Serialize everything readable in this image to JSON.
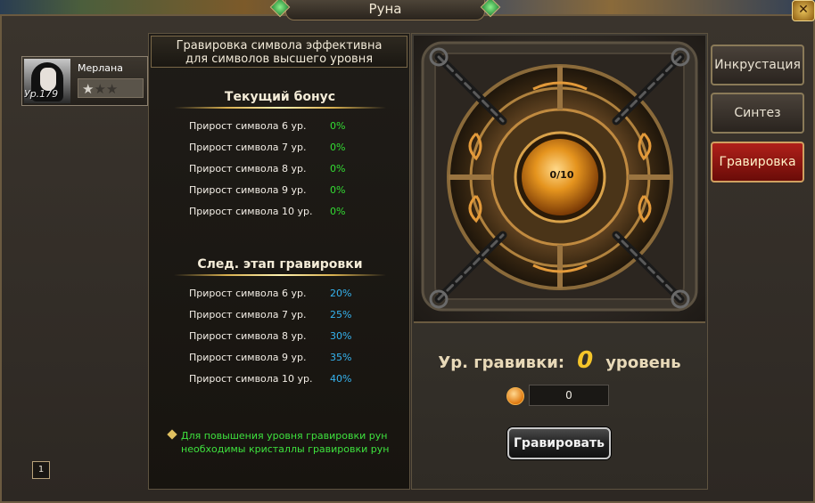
{
  "window": {
    "title": "Руна"
  },
  "character": {
    "name": "Мерлана",
    "level": "Ур.179",
    "stars_filled": 1,
    "stars_total": 3
  },
  "page_indicator": "1",
  "info": {
    "header_line1": "Гравировка символа эффективна",
    "header_line2": "для символов высшего уровня",
    "current_bonus_title": "Текущий бонус",
    "current_bonus": [
      {
        "label": "Прирост символа 6 ур.",
        "value": "0%"
      },
      {
        "label": "Прирост символа 7 ур.",
        "value": "0%"
      },
      {
        "label": "Прирост символа 8 ур.",
        "value": "0%"
      },
      {
        "label": "Прирост символа 9 ур.",
        "value": "0%"
      },
      {
        "label": "Прирост символа 10 ур.",
        "value": "0%"
      }
    ],
    "next_stage_title": "След. этап гравировки",
    "next_stage": [
      {
        "label": "Прирост символа 6 ур.",
        "value": "20%"
      },
      {
        "label": "Прирост символа 7 ур.",
        "value": "25%"
      },
      {
        "label": "Прирост символа 8 ур.",
        "value": "30%"
      },
      {
        "label": "Прирост символа 9 ур.",
        "value": "35%"
      },
      {
        "label": "Прирост символа 10 ур.",
        "value": "40%"
      }
    ],
    "hint_line1": "Для повышения уровня гравировки рун",
    "hint_line2": "необходимы кристаллы гравировки рун"
  },
  "engrave": {
    "progress": "0/10",
    "level_label": "Ур. гравивки:",
    "level_value": "0",
    "level_suffix": "уровень",
    "crystals": "0",
    "button_label": "Гравировать"
  },
  "tabs": [
    {
      "label": "Инкрустация",
      "active": false
    },
    {
      "label": "Синтез",
      "active": false
    },
    {
      "label": "Гравировка",
      "active": true
    }
  ],
  "colors": {
    "bonus_current": "#33dd33",
    "bonus_next": "#36b4f0",
    "hint": "#3ee23e",
    "tab_active": "#b0201a",
    "level_value": "#f5c52a"
  }
}
